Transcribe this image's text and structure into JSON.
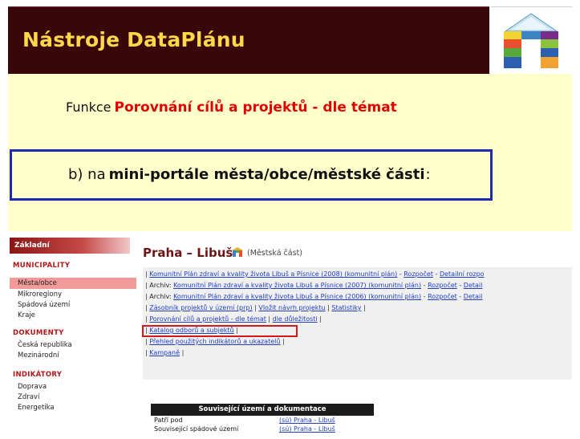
{
  "header": {
    "title": "Nástroje DataPlánu"
  },
  "explanation": {
    "function_prefix": "Funkce",
    "function_name": "Porovnání cílů a projektů - dle témat",
    "portal_prefix": "b) na",
    "portal_strong": "mini-portále města/obce/městské části",
    "portal_colon": ":"
  },
  "sidebar": {
    "head": "Základní",
    "sections": [
      {
        "label": "MUNICIPALITY",
        "items": [
          "Města/obce",
          "Mikroregiony",
          "Spádová území",
          "Kraje"
        ]
      },
      {
        "label": "DOKUMENTY",
        "items": [
          "Česká republika",
          "Mezinárodní"
        ]
      },
      {
        "label": "INDIKÁTORY",
        "items": [
          "Doprava",
          "Zdraví",
          "Energetika"
        ]
      }
    ]
  },
  "page": {
    "title": "Praha – Libuš",
    "subtitle": "(Městská část)"
  },
  "links": {
    "line1": {
      "a": "Komunitní Plán zdraví a kvality života Libuš a Písnice (2008) (komunitní plán)",
      "b": "Rozpočet",
      "c": "Detailní rozpo"
    },
    "line2": {
      "prefix": "Archiv:",
      "a": "Komunitní Plán zdraví a kvality života Libuš a Písnice (2007) (komunitní plán)",
      "b": "Rozpočet",
      "c": "Detail"
    },
    "line3": {
      "prefix": "Archiv:",
      "a": "Komunitní Plán zdraví a kvality života Libuš a Písnice (2006) (komunitní plán)",
      "b": "Rozpočet",
      "c": "Detail"
    },
    "line4": {
      "a": "Zásobník projektů v území (prp)",
      "b": "Vložit návrh projektu",
      "c": "Statistiky"
    },
    "line5": {
      "a": "Porovnání cílů a projektů - dle témat",
      "b": "dle důležitosti"
    },
    "line6": {
      "a": "Katalog odborů a subjektů"
    },
    "line7": {
      "a": "Přehled použitých indikátorů a ukazatelů"
    },
    "line8": {
      "a": "Kampaně"
    }
  },
  "related": {
    "head": "Související území a dokumentace",
    "rows": [
      {
        "key": "Patří pod",
        "value": "(sú) Praha - Libuš"
      },
      {
        "key": "Související spádové území",
        "value": "(sú) Praha - Libuš"
      }
    ]
  },
  "colors": {
    "header_bg": "#3a0708",
    "header_text": "#ffd84a",
    "panel_bg": "#ffffcc",
    "accent_red": "#e00000",
    "box_blue": "#1c2bb0",
    "link_blue": "#1f3fbf"
  },
  "icons": {
    "logo": "dataplan-arch-logo",
    "title_icon": "town-hall-icon"
  }
}
